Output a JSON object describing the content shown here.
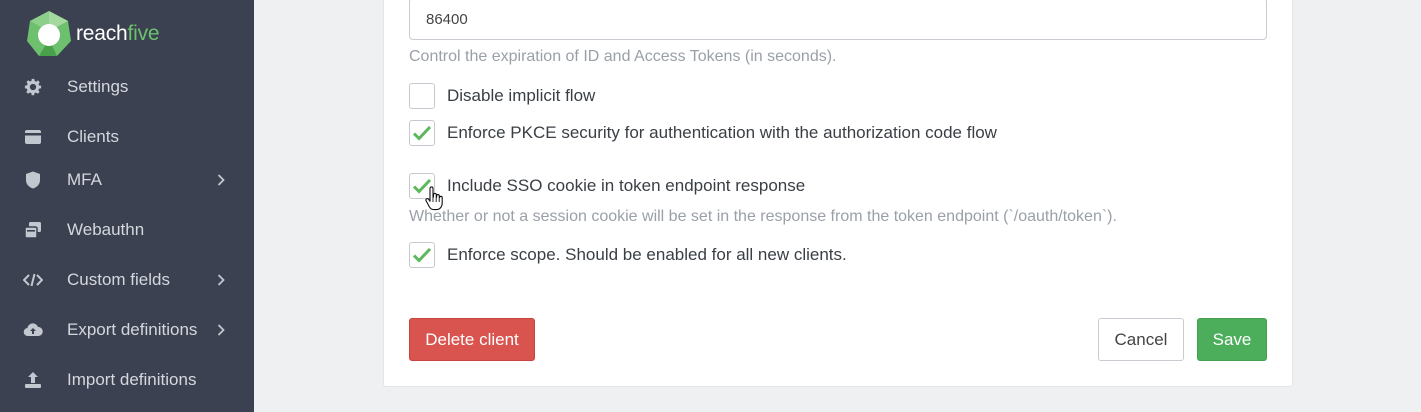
{
  "brand": {
    "name_part1": "reach",
    "name_part2": "five"
  },
  "sidebar": {
    "items": [
      {
        "label": "Settings",
        "icon": "gear-icon",
        "has_submenu": false
      },
      {
        "label": "Clients",
        "icon": "card-icon",
        "has_submenu": false
      },
      {
        "label": "MFA",
        "icon": "shield-icon",
        "has_submenu": true
      },
      {
        "label": "Webauthn",
        "icon": "copy-icon",
        "has_submenu": false
      },
      {
        "label": "Custom fields",
        "icon": "code-icon",
        "has_submenu": true
      },
      {
        "label": "Export definitions",
        "icon": "cloud-upload-icon",
        "has_submenu": true
      },
      {
        "label": "Import definitions",
        "icon": "upload-icon",
        "has_submenu": false
      }
    ]
  },
  "form": {
    "token_lifetime_value": "86400",
    "token_lifetime_help": "Control the expiration of ID and Access Tokens (in seconds).",
    "options": [
      {
        "label": "Disable implicit flow",
        "checked": false
      },
      {
        "label": "Enforce PKCE security for authentication with the authorization code flow",
        "checked": true
      },
      {
        "label": "Include SSO cookie in token endpoint response",
        "checked": true
      },
      {
        "label": "Enforce scope. Should be enabled for all new clients.",
        "checked": true
      }
    ],
    "sso_cookie_help": "Whether or not a session cookie will be set in the response from the token endpoint (`/oauth/token`)."
  },
  "actions": {
    "delete_label": "Delete client",
    "cancel_label": "Cancel",
    "save_label": "Save"
  },
  "colors": {
    "sidebar_bg": "#3b4150",
    "brand_green": "#6dc16e",
    "danger": "#d9534f",
    "success": "#4cae5a",
    "check": "#5cb85c"
  }
}
